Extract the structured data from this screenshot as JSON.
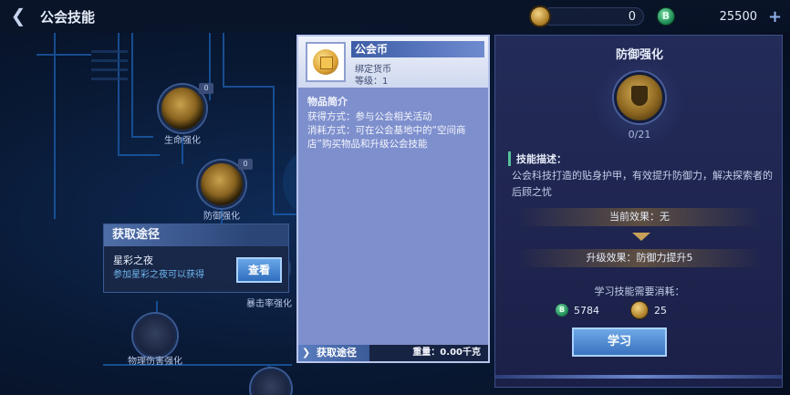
{
  "header": {
    "title": "公会技能",
    "currency_coin_value": "0",
    "currency_gem_value": "25500",
    "gem_letter": "B"
  },
  "skill_tree": {
    "nodes": [
      {
        "label": "生命强化",
        "level": "0"
      },
      {
        "label": "防御强化",
        "level": "0"
      },
      {
        "label": "暴击率强化",
        "level": ""
      },
      {
        "label": "物理伤害强化",
        "level": ""
      }
    ]
  },
  "acquire_popup": {
    "title": "获取途径",
    "source_name": "星彩之夜",
    "source_desc": "参加星彩之夜可以获得",
    "view_button": "查看"
  },
  "item_panel": {
    "name": "公会币",
    "subtype": "绑定货币",
    "level": "等级：1",
    "section_title": "物品简介",
    "desc_line1": "获得方式：参与公会相关活动",
    "desc_line2": "消耗方式：可在公会基地中的“空间商店”购买物品和升级公会技能",
    "footer_tab": "获取途径",
    "weight": "重量：0.00千克"
  },
  "skill_panel": {
    "title": "防御强化",
    "progress": "0/21",
    "desc_label": "技能描述：",
    "desc": "公会科技打造的贴身护甲，有效提升防御力，解决探索者的后顾之忧",
    "current_effect": "当前效果：无",
    "upgrade_effect": "升级效果：防御力提升5",
    "cost_label": "学习技能需要消耗：",
    "cost_gem": "5784",
    "cost_coin": "25",
    "learn_button": "学习"
  },
  "colors": {
    "accent_blue": "#3a72bf",
    "panel_purple": "#7e8fcd",
    "gold": "#c8a058",
    "green_tag": "#56c19a"
  }
}
